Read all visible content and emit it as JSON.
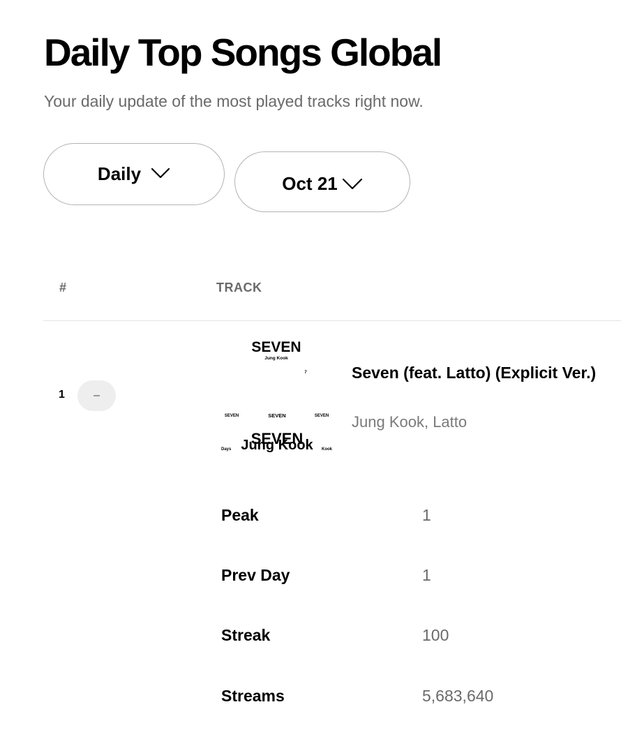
{
  "header": {
    "title": "Daily Top Songs Global",
    "subtitle": "Your daily update of the most played tracks right now."
  },
  "filters": {
    "period_label": "Daily",
    "date_label": "Oct 21"
  },
  "table": {
    "columns": {
      "rank": "#",
      "track": "TRACK"
    },
    "rows": [
      {
        "rank": "1",
        "movement": "–",
        "title": "Seven (feat. Latto) (Explicit Ver.)",
        "artist": "Jung Kook, Latto",
        "cover_art": {
          "text_main": "SEVEN",
          "text_artist": "Jung Kook",
          "text_small": "7",
          "text_left": "SEVEN",
          "text_center": "SEVEN",
          "text_right": "SEVEN",
          "text_bottom_big": "SEVEN",
          "text_bottom_overlay": "Jung Kook",
          "text_bottom_left": "Days",
          "text_bottom_right": "Kook"
        },
        "stats": [
          {
            "label": "Peak",
            "value": "1"
          },
          {
            "label": "Prev Day",
            "value": "1"
          },
          {
            "label": "Streak",
            "value": "100"
          },
          {
            "label": "Streams",
            "value": "5,683,640"
          }
        ]
      }
    ]
  },
  "icons": {
    "dropdown": "chevron-down-icon",
    "movement": "dash-icon"
  }
}
